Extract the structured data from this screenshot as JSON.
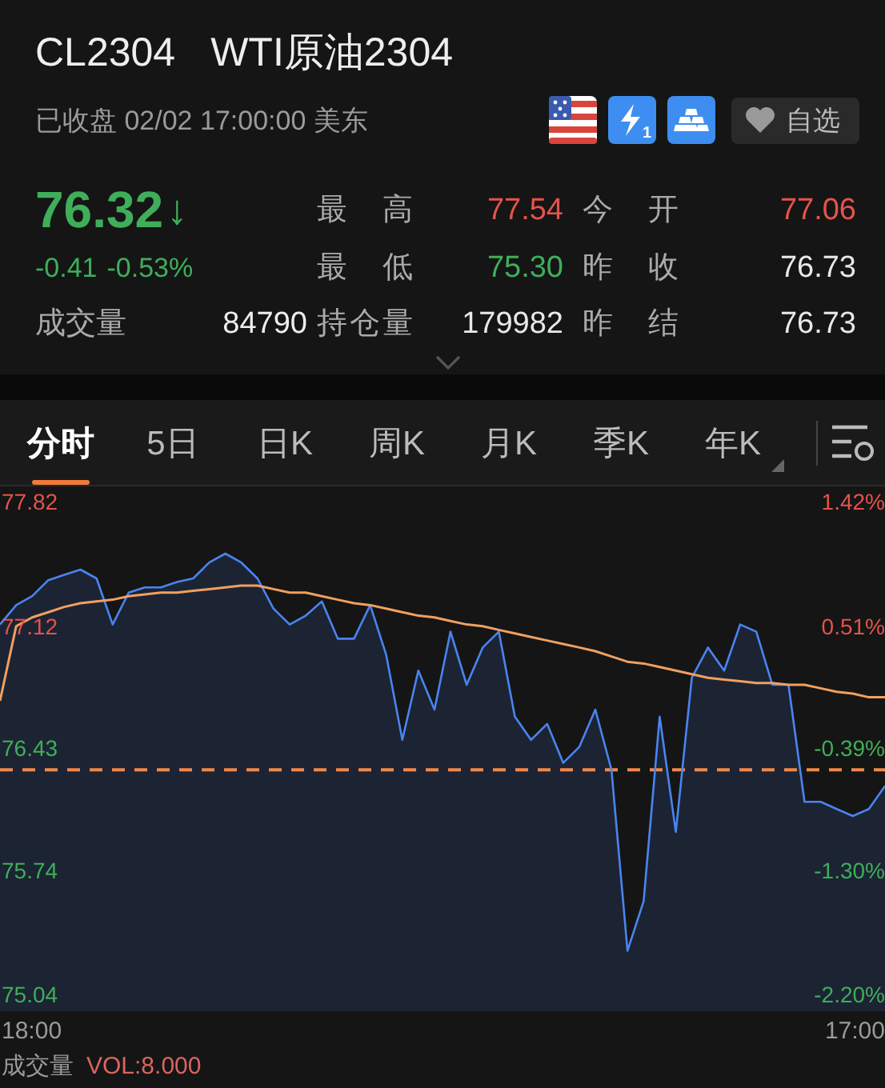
{
  "header": {
    "symbol": "CL2304",
    "name": "WTI原油2304",
    "status": "已收盘 02/02 17:00:00 美东",
    "badges": [
      {
        "kind": "flag"
      },
      {
        "kind": "bolt",
        "text": "1"
      },
      {
        "kind": "gold"
      }
    ],
    "watchlist_button": "自选"
  },
  "quote": {
    "price": "76.32",
    "arrow": "↓",
    "color": "#3fae5a",
    "change": "-0.41",
    "change_pct": "-0.53%"
  },
  "volume": {
    "label": "成交量",
    "value": "84790"
  },
  "stats": [
    {
      "label": "最 高",
      "value": "77.54",
      "color": "#e5534b"
    },
    {
      "label": "今 开",
      "value": "77.06",
      "color": "#e5534b"
    },
    {
      "label": "最 低",
      "value": "75.30",
      "color": "#3fae5a"
    },
    {
      "label": "昨 收",
      "value": "76.73",
      "color": "#e8e8e8"
    },
    {
      "label": "持仓量",
      "value": "179982",
      "color": "#e8e8e8"
    },
    {
      "label": "昨 结",
      "value": "76.73",
      "color": "#e8e8e8"
    }
  ],
  "tabs": [
    {
      "label": "分时",
      "selected": true,
      "has_menu": false
    },
    {
      "label": "5日",
      "selected": false,
      "has_menu": false
    },
    {
      "label": "日K",
      "selected": false,
      "has_menu": false
    },
    {
      "label": "周K",
      "selected": false,
      "has_menu": false
    },
    {
      "label": "月K",
      "selected": false,
      "has_menu": false
    },
    {
      "label": "季K",
      "selected": false,
      "has_menu": false
    },
    {
      "label": "年K",
      "selected": false,
      "has_menu": true
    }
  ],
  "chart": {
    "chart_data": {
      "type": "line",
      "series": [
        {
          "type": "area",
          "color": "#4a84f0",
          "values": [
            77.14,
            77.25,
            77.3,
            77.39,
            77.42,
            77.45,
            77.4,
            77.14,
            77.32,
            77.35,
            77.35,
            77.38,
            77.4,
            77.49,
            77.54,
            77.49,
            77.4,
            77.23,
            77.14,
            77.19,
            77.27,
            77.06,
            77.06,
            77.25,
            76.97,
            76.49,
            76.88,
            76.66,
            77.1,
            76.8,
            77.01,
            77.1,
            76.62,
            76.49,
            76.58,
            76.36,
            76.45,
            76.66,
            76.32,
            75.3,
            75.58,
            76.62,
            75.97,
            76.84,
            77.01,
            76.88,
            77.14,
            77.1,
            76.8,
            76.8,
            76.14,
            76.14,
            76.1,
            76.06,
            76.1,
            76.23
          ]
        },
        {
          "type": "line",
          "color": "#f0a060",
          "values": [
            76.71,
            77.13,
            77.18,
            77.21,
            77.24,
            77.26,
            77.27,
            77.28,
            77.3,
            77.31,
            77.32,
            77.32,
            77.33,
            77.34,
            77.35,
            77.36,
            77.36,
            77.34,
            77.32,
            77.32,
            77.3,
            77.28,
            77.26,
            77.25,
            77.23,
            77.21,
            77.19,
            77.18,
            77.16,
            77.14,
            77.13,
            77.11,
            77.09,
            77.07,
            77.05,
            77.03,
            77.01,
            76.99,
            76.96,
            76.93,
            76.92,
            76.9,
            76.88,
            76.86,
            76.84,
            76.83,
            76.82,
            76.81,
            76.81,
            76.8,
            76.8,
            76.78,
            76.76,
            76.75,
            76.73,
            76.73
          ]
        }
      ],
      "ylim": [
        75.04,
        77.82
      ],
      "yticks": [
        {
          "value": 77.82,
          "label": "77.82"
        },
        {
          "value": 77.12,
          "label": "77.12"
        },
        {
          "value": 76.43,
          "label": "76.43"
        },
        {
          "value": 75.74,
          "label": "75.74"
        },
        {
          "value": 75.04,
          "label": "75.04"
        }
      ],
      "ref_lines": [
        {
          "axis": "y",
          "value": 76.32,
          "color": "#f0884a"
        }
      ]
    },
    "time_labels": [
      "18:00",
      "17:00"
    ],
    "right_labels": [
      {
        "text": "1.42%",
        "color": "#e5534b"
      },
      {
        "text": "0.51%",
        "color": "#e5534b"
      },
      {
        "text": "-0.39%",
        "color": "#3fae5a"
      },
      {
        "text": "-1.30%",
        "color": "#3fae5a"
      },
      {
        "text": "-2.20%",
        "color": "#3fae5a"
      }
    ]
  },
  "footer": {
    "volume_label": "成交量",
    "volume_value": "VOL:8.000"
  }
}
